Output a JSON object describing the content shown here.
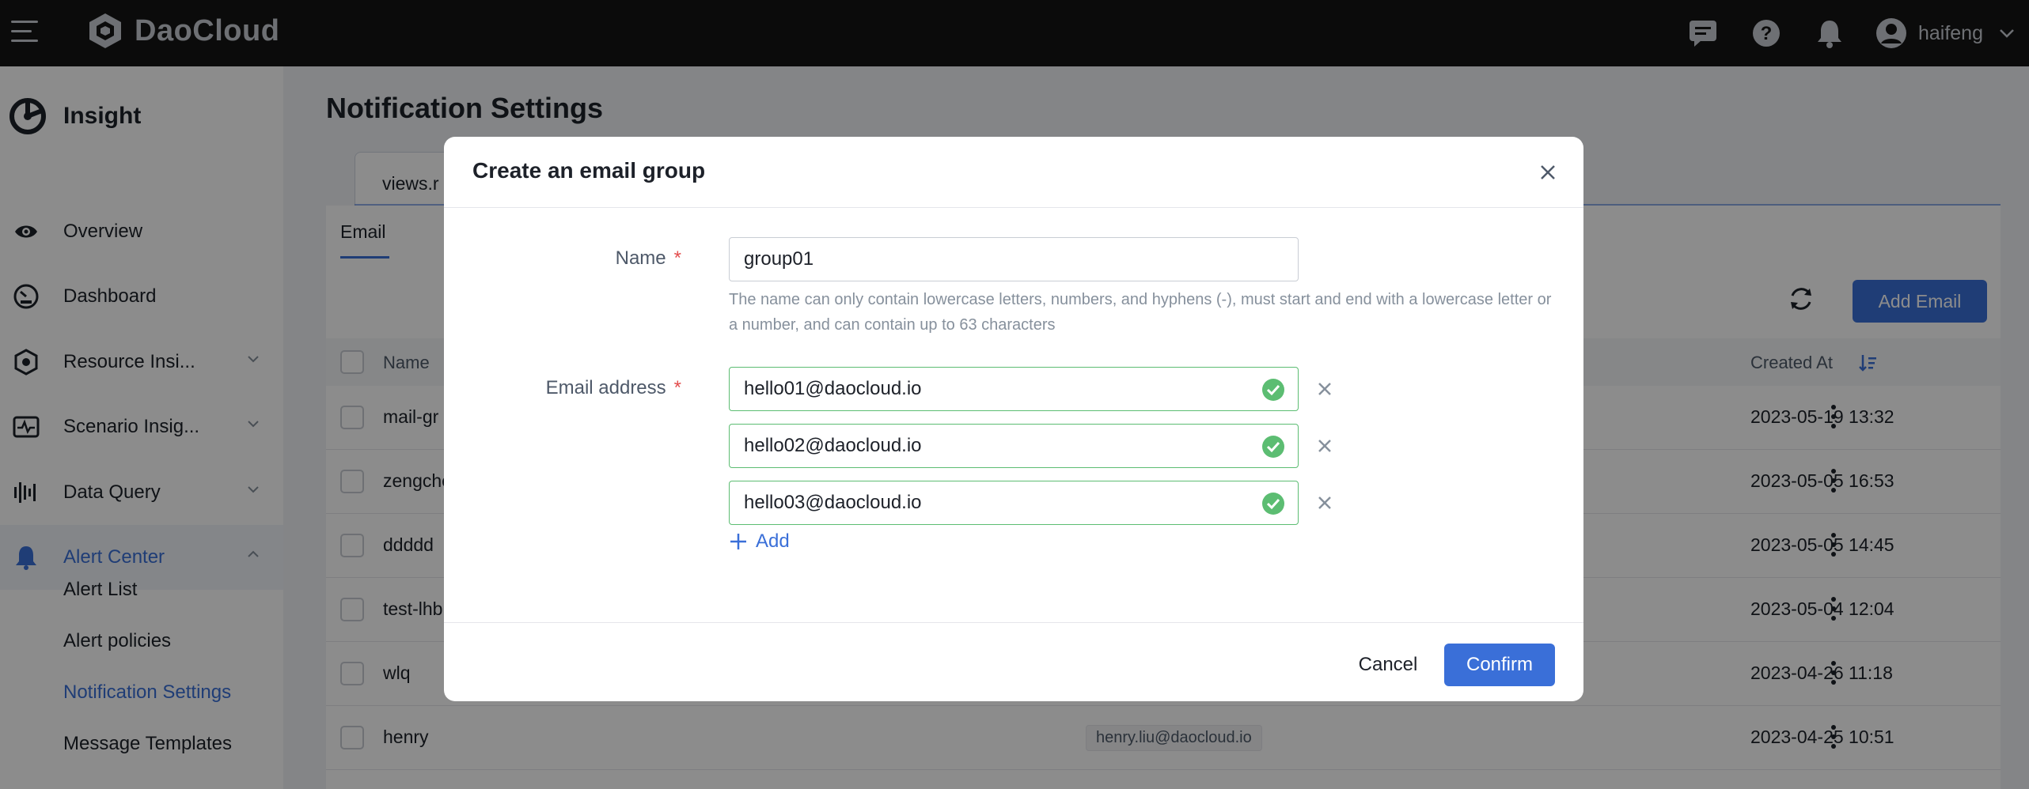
{
  "topbar": {
    "brand": "DaoCloud",
    "username": "haifeng"
  },
  "sidebar": {
    "module_title": "Insight",
    "items": [
      {
        "label": "Overview"
      },
      {
        "label": "Dashboard"
      },
      {
        "label": "Resource Insi..."
      },
      {
        "label": "Scenario Insig..."
      },
      {
        "label": "Data Query"
      },
      {
        "label": "Alert Center"
      }
    ],
    "sub_items": [
      {
        "label": "Alert List"
      },
      {
        "label": "Alert policies"
      },
      {
        "label": "Notification Settings"
      },
      {
        "label": "Message Templates"
      }
    ]
  },
  "page": {
    "title": "Notification Settings",
    "tab_label": "views.r",
    "subtab": "Email",
    "add_email_label": "Add Email",
    "columns": {
      "name": "Name",
      "created_at": "Created At"
    },
    "rows": [
      {
        "name": "mail-gr",
        "date": "2023-05-19 13:32"
      },
      {
        "name": "zengche",
        "date": "2023-05-05 16:53"
      },
      {
        "name": "ddddd",
        "date": "2023-05-05 14:45"
      },
      {
        "name": "test-lhb",
        "date": "2023-05-04 12:04"
      },
      {
        "name": "wlq",
        "date": "2023-04-26 11:18"
      },
      {
        "name": "henry",
        "date": "2023-04-25 10:51",
        "email": "henry.liu@daocloud.io"
      }
    ]
  },
  "modal": {
    "title": "Create an email group",
    "name_label": "Name",
    "name_value": "group01",
    "name_hint": "The name can only contain lowercase letters, numbers, and hyphens (-), must start and end with a lowercase letter or a number, and can contain up to 63 characters",
    "email_label": "Email address",
    "emails": [
      "hello01@daocloud.io",
      "hello02@daocloud.io",
      "hello03@daocloud.io"
    ],
    "add_label": "Add",
    "cancel_label": "Cancel",
    "confirm_label": "Confirm"
  },
  "colors": {
    "accent": "#3a6fd8",
    "valid": "#5cbd72",
    "topbar": "#141414"
  }
}
